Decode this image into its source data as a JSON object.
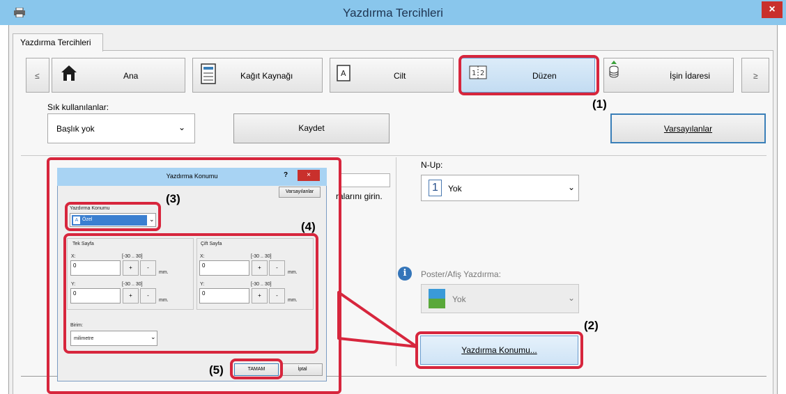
{
  "window": {
    "title": "Yazdırma Tercihleri",
    "close": "×"
  },
  "tab": {
    "label": "Yazdırma Tercihleri"
  },
  "toolbar": {
    "prev": "≤",
    "next": "≥",
    "tabs": [
      {
        "label": "Ana",
        "icon": "home-icon"
      },
      {
        "label": "Kağıt Kaynağı",
        "icon": "paper-tray-icon"
      },
      {
        "label": "Cilt",
        "icon": "binding-icon"
      },
      {
        "label": "Düzen",
        "icon": "layout-icon"
      },
      {
        "label": "İşin İdaresi",
        "icon": "job-handling-icon"
      }
    ]
  },
  "favorites": {
    "label": "Sık kullanılanlar:",
    "value": "Başlık yok",
    "save": "Kaydet",
    "defaults": "Varsayılanlar"
  },
  "partial_text": "ralarını girin.",
  "nup": {
    "label": "N-Up:",
    "value": "Yok",
    "icon_glyph": "1"
  },
  "poster": {
    "label": "Poster/Afiş Yazdırma:",
    "value": "Yok"
  },
  "print_position_button": "Yazdırma Konumu...",
  "callouts": {
    "c1": "(1)",
    "c2": "(2)",
    "c3": "(3)",
    "c4": "(4)",
    "c5": "(5)"
  },
  "dialog": {
    "title": "Yazdırma Konumu",
    "help": "?",
    "close": "×",
    "defaults": "Varsayılanlar",
    "position_label": "Yazdırma Konumu",
    "position_value": "Özel",
    "single": {
      "title": "Tek Sayfa",
      "x_label": "X:",
      "x_range": "[-30 .. 30]",
      "x_value": "0",
      "y_label": "Y:",
      "y_range": "[-30 .. 30]",
      "y_value": "0",
      "unit": "mm."
    },
    "double": {
      "title": "Çift Sayfa",
      "x_label": "X:",
      "x_range": "[-30 .. 30]",
      "x_value": "0",
      "y_label": "Y:",
      "y_range": "[-30 .. 30]",
      "y_value": "0",
      "unit": "mm."
    },
    "plus": "+",
    "minus": "-",
    "unit_label": "Birim:",
    "unit_value": "milimetre",
    "ok": "TAMAM",
    "cancel": "İptal"
  },
  "colors": {
    "highlight": "#d7263d",
    "titlebar": "#89c6ec",
    "selected_tab": "#cfe6f8"
  }
}
